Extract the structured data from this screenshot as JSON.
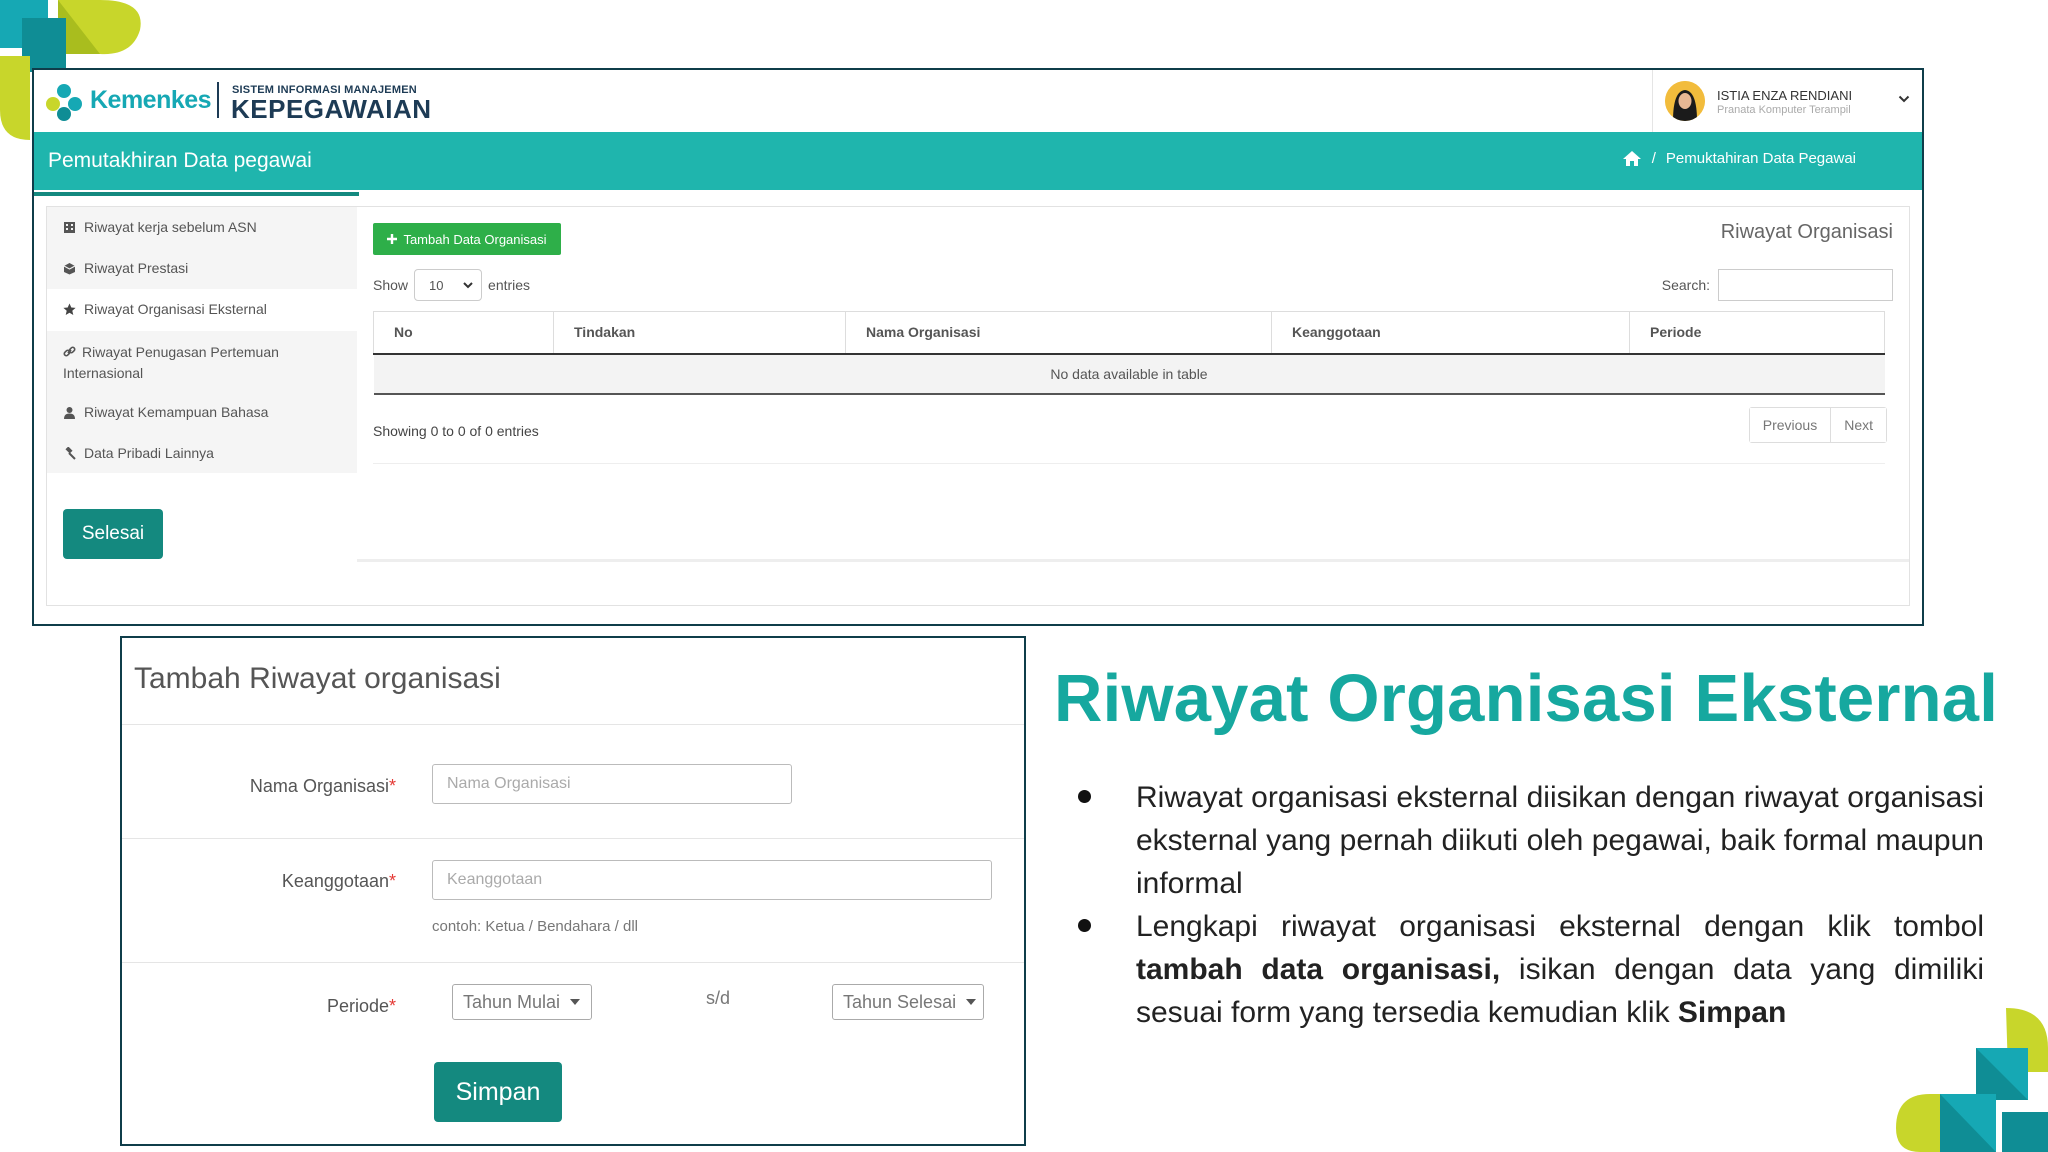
{
  "header": {
    "brand": "Kemenkes",
    "system_small": "SISTEM INFORMASI MANAJEMEN",
    "system_big": "KEPEGAWAIAN",
    "user_name": "ISTIA ENZA RENDIANI",
    "user_role": "Pranata Komputer Terampil"
  },
  "banner": {
    "title": "Pemutakhiran Data pegawai",
    "breadcrumb_sep": "/",
    "breadcrumb": "Pemuktahiran Data Pegawai"
  },
  "sidebar": {
    "items": [
      {
        "label": "Riwayat kerja sebelum ASN",
        "icon": "building-icon"
      },
      {
        "label": "Riwayat Prestasi",
        "icon": "cube-icon"
      },
      {
        "label": "Riwayat Organisasi Eksternal",
        "icon": "star-icon"
      },
      {
        "label": "Riwayat Penugasan Pertemuan Internasional",
        "icon": "link-icon"
      },
      {
        "label": "Riwayat Kemampuan Bahasa",
        "icon": "user-icon"
      },
      {
        "label": "Data Pribadi Lainnya",
        "icon": "gavel-icon"
      }
    ],
    "finish_button": "Selesai"
  },
  "panel": {
    "add_button": "Tambah Data Organisasi",
    "title": "Riwayat Organisasi",
    "show_label": "Show",
    "entries_value": "10",
    "entries_label": "entries",
    "search_label": "Search:",
    "columns": [
      "No",
      "Tindakan",
      "Nama Organisasi",
      "Keanggotaan",
      "Periode"
    ],
    "empty_text": "No data available in table",
    "info": "Showing 0 to 0 of 0 entries",
    "prev": "Previous",
    "next": "Next"
  },
  "form": {
    "title": "Tambah Riwayat organisasi",
    "nama_label": "Nama Organisasi",
    "nama_placeholder": "Nama Organisasi",
    "anggota_label": "Keanggotaan",
    "anggota_placeholder": "Keanggotaan",
    "anggota_help": "contoh: Ketua / Bendahara / dll",
    "periode_label": "Periode",
    "required_mark": "*",
    "tahun_mulai": "Tahun Mulai",
    "sd": "s/d",
    "tahun_selesai": "Tahun Selesai",
    "save_button": "Simpan"
  },
  "description": {
    "heading": "Riwayat Organisasi Eksternal",
    "bullet1": "Riwayat organisasi eksternal diisikan dengan riwayat organisasi eksternal yang pernah diikuti oleh pegawai, baik formal maupun informal",
    "bullet2_pre": "Lengkapi riwayat organisasi eksternal dengan klik tombol ",
    "bullet2_bold1": "tambah data organisasi,",
    "bullet2_mid": " isikan dengan data yang dimiliki sesuai form yang tersedia kemudian klik ",
    "bullet2_bold2": "Simpan"
  },
  "colors": {
    "teal": "#1fb5ad",
    "dark_teal": "#14897f",
    "green": "#2eaf49",
    "heading": "#16a89f",
    "lime": "#c8d62b",
    "navy": "#1d3b55"
  }
}
